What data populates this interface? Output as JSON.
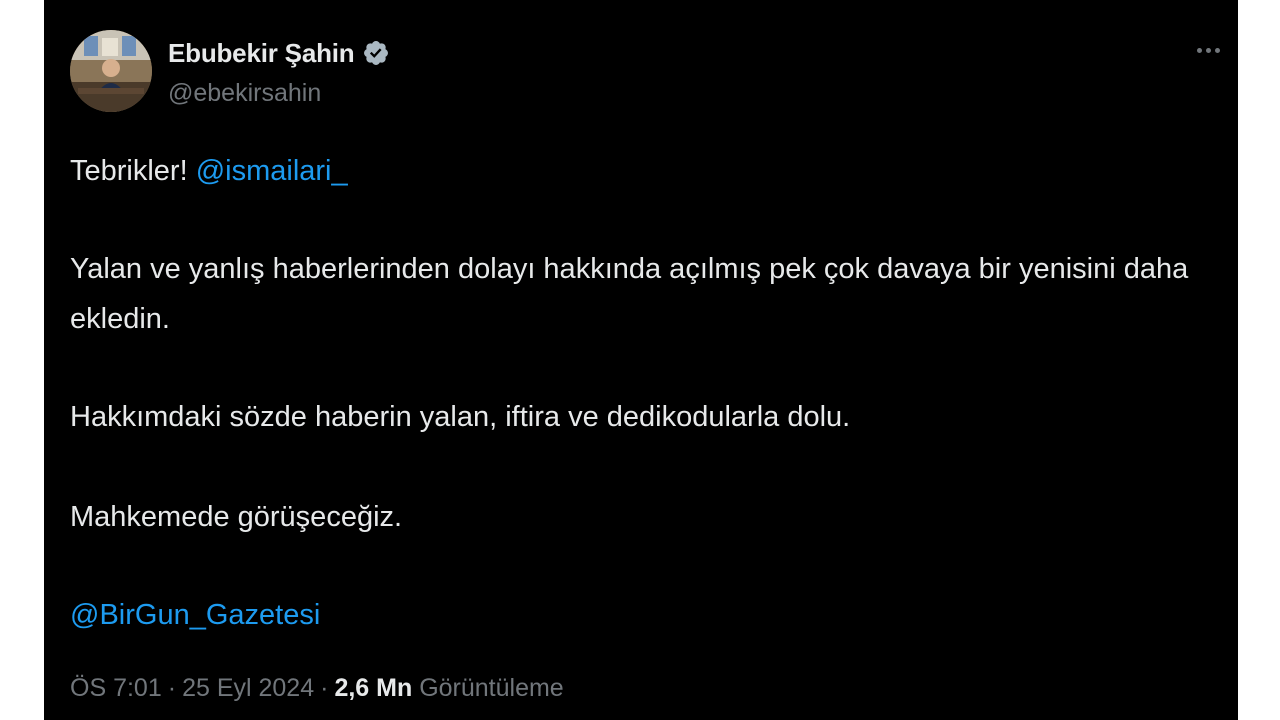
{
  "author": {
    "display_name": "Ebubekir Şahin",
    "handle": "@ebekirsahin",
    "verified": true,
    "avatar_icon": "profile-photo"
  },
  "tweet": {
    "greeting": "Tebrikler!",
    "mention_1": "@ismailari_",
    "paragraph_2": "Yalan ve yanlış haberlerinden dolayı hakkında açılmış pek çok davaya bir yenisini daha ekledin.",
    "paragraph_3": "Hakkımdaki sözde haberin yalan, iftira ve dedikodularla dolu.",
    "paragraph_4": "Mahkemede görüşeceğiz.",
    "mention_2": "@BirGun_Gazetesi"
  },
  "meta": {
    "time": "ÖS 7:01",
    "separator": "·",
    "date": "25 Eyl 2024",
    "views_count": "2,6 Mn",
    "views_label": "Görüntüleme"
  },
  "colors": {
    "background": "#000000",
    "text": "#e7e9ea",
    "secondary": "#71767b",
    "accent": "#1d9bf0"
  },
  "icons": {
    "verified": "verified-badge-icon",
    "more": "more-options-icon"
  }
}
